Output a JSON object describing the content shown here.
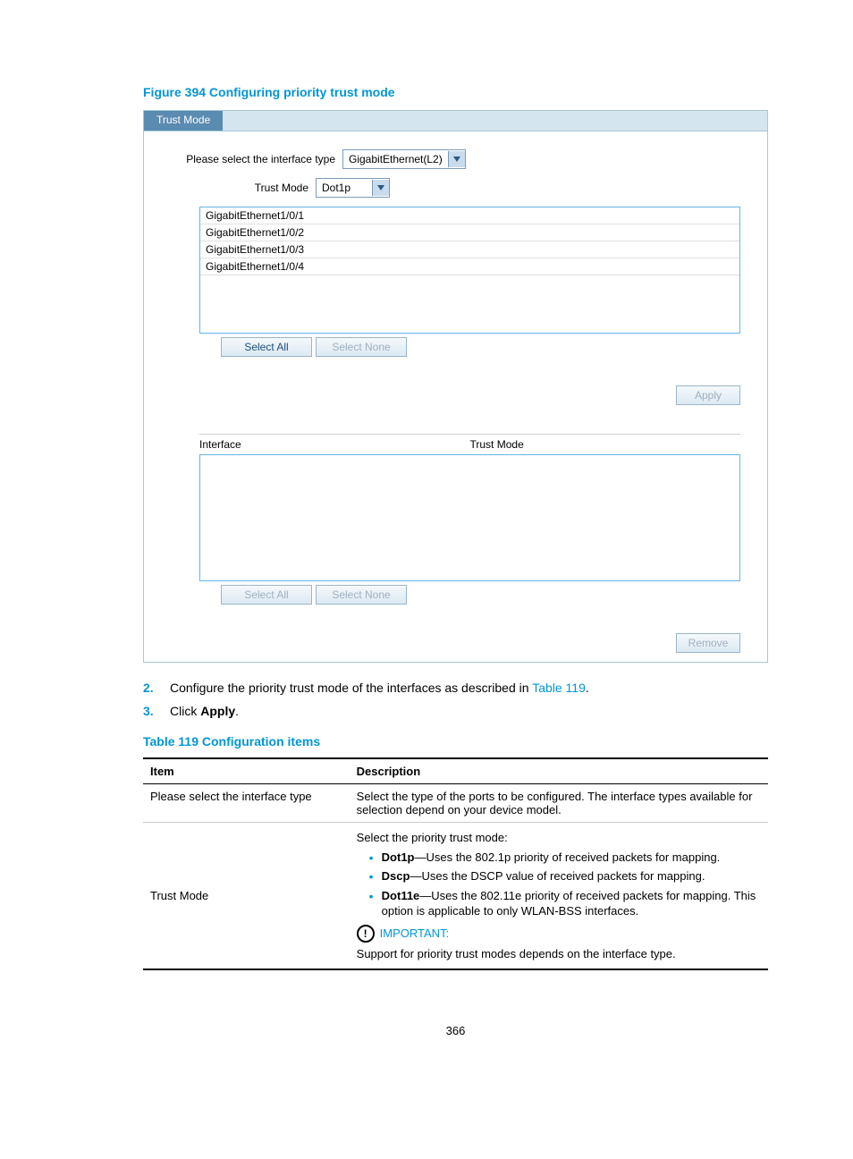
{
  "figure_caption": "Figure 394 Configuring priority trust mode",
  "panel": {
    "tab_label": "Trust Mode",
    "interface_type_label": "Please select the interface type",
    "interface_type_value": "GigabitEthernet(L2)",
    "trust_mode_label": "Trust Mode",
    "trust_mode_value": "Dot1p",
    "interfaces": [
      "GigabitEthernet1/0/1",
      "GigabitEthernet1/0/2",
      "GigabitEthernet1/0/3",
      "GigabitEthernet1/0/4"
    ],
    "select_all": "Select All",
    "select_none": "Select None",
    "apply": "Apply",
    "result_col_interface": "Interface",
    "result_col_trust_mode": "Trust Mode",
    "select_all2": "Select All",
    "select_none2": "Select None",
    "remove": "Remove"
  },
  "steps": {
    "s2_num": "2.",
    "s2_text_a": "Configure the priority trust mode of the interfaces as described in ",
    "s2_link": "Table 119",
    "s2_text_b": ".",
    "s3_num": "3.",
    "s3_text_a": "Click ",
    "s3_bold": "Apply",
    "s3_text_b": "."
  },
  "table_caption": "Table 119 Configuration items",
  "table": {
    "h_item": "Item",
    "h_desc": "Description",
    "r1_item": "Please select the interface type",
    "r1_desc": "Select the type of the ports to be configured. The interface types available for selection depend on your device model.",
    "r2_item": "Trust Mode",
    "r2_intro": "Select the priority trust mode:",
    "r2_b1_bold": "Dot1p",
    "r2_b1_text": "—Uses the 802.1p priority of received packets for mapping.",
    "r2_b2_bold": "Dscp",
    "r2_b2_text": "—Uses the DSCP value of received packets for mapping.",
    "r2_b3_bold": "Dot11e",
    "r2_b3_text": "—Uses the 802.11e priority of received packets for mapping. This option is applicable to only WLAN-BSS interfaces.",
    "r2_important": "IMPORTANT:",
    "r2_support": "Support for priority trust modes depends on the interface type."
  },
  "page_number": "366"
}
